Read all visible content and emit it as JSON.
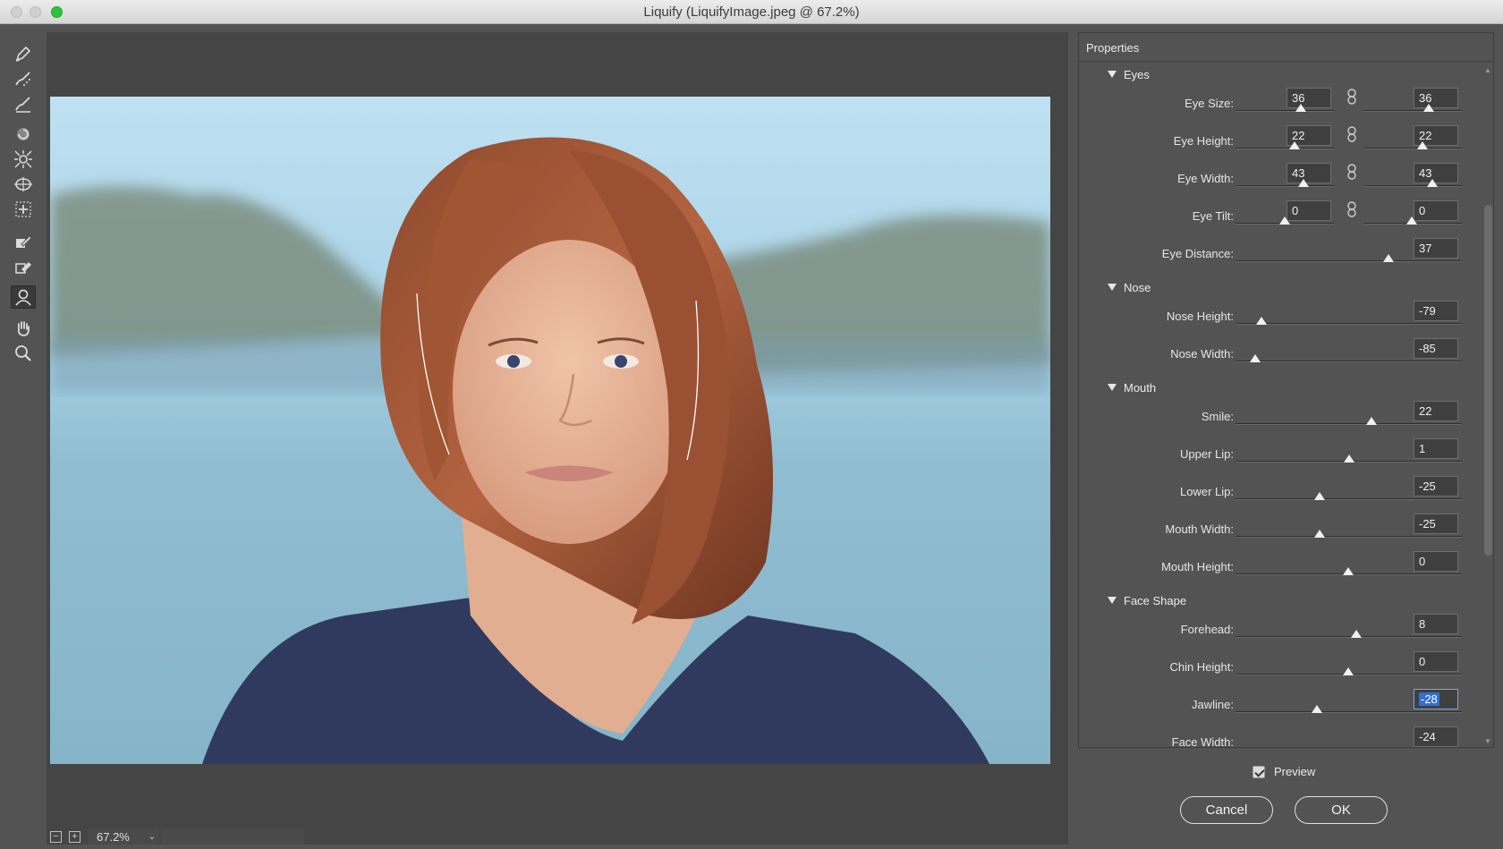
{
  "window": {
    "title": "Liquify (LiquifyImage.jpeg @ 67.2%)"
  },
  "tools": [
    {
      "name": "forward-warp-tool-icon"
    },
    {
      "name": "reconstruct-tool-icon"
    },
    {
      "name": "smooth-tool-icon"
    },
    {
      "name": "twirl-clockwise-tool-icon"
    },
    {
      "name": "pucker-tool-icon"
    },
    {
      "name": "bloat-tool-icon"
    },
    {
      "name": "push-left-tool-icon"
    },
    {
      "name": "freeze-mask-tool-icon"
    },
    {
      "name": "thaw-mask-tool-icon"
    },
    {
      "name": "face-tool-icon",
      "active": true
    },
    {
      "name": "hand-tool-icon"
    },
    {
      "name": "zoom-tool-icon"
    }
  ],
  "zoom": {
    "value": "67.2%"
  },
  "properties": {
    "header": "Properties",
    "sections": {
      "eyes": "Eyes",
      "nose": "Nose",
      "mouth": "Mouth",
      "face_shape": "Face Shape"
    },
    "eyes": {
      "eye_size": {
        "label": "Eye Size:",
        "left": "36",
        "right": "36"
      },
      "eye_height": {
        "label": "Eye Height:",
        "left": "22",
        "right": "22"
      },
      "eye_width": {
        "label": "Eye Width:",
        "left": "43",
        "right": "43"
      },
      "eye_tilt": {
        "label": "Eye Tilt:",
        "left": "0",
        "right": "0"
      },
      "eye_distance": {
        "label": "Eye Distance:",
        "value": "37"
      }
    },
    "nose": {
      "nose_height": {
        "label": "Nose Height:",
        "value": "-79"
      },
      "nose_width": {
        "label": "Nose Width:",
        "value": "-85"
      }
    },
    "mouth": {
      "smile": {
        "label": "Smile:",
        "value": "22"
      },
      "upper_lip": {
        "label": "Upper Lip:",
        "value": "1"
      },
      "lower_lip": {
        "label": "Lower Lip:",
        "value": "-25"
      },
      "mouth_width": {
        "label": "Mouth Width:",
        "value": "-25"
      },
      "mouth_height": {
        "label": "Mouth Height:",
        "value": "0"
      }
    },
    "face_shape": {
      "forehead": {
        "label": "Forehead:",
        "value": "8"
      },
      "chin_height": {
        "label": "Chin Height:",
        "value": "0"
      },
      "jawline": {
        "label": "Jawline:",
        "value": "-28"
      },
      "face_width": {
        "label": "Face Width:",
        "value": "-24"
      }
    }
  },
  "preview": {
    "label": "Preview",
    "checked": true
  },
  "buttons": {
    "cancel": "Cancel",
    "ok": "OK"
  }
}
